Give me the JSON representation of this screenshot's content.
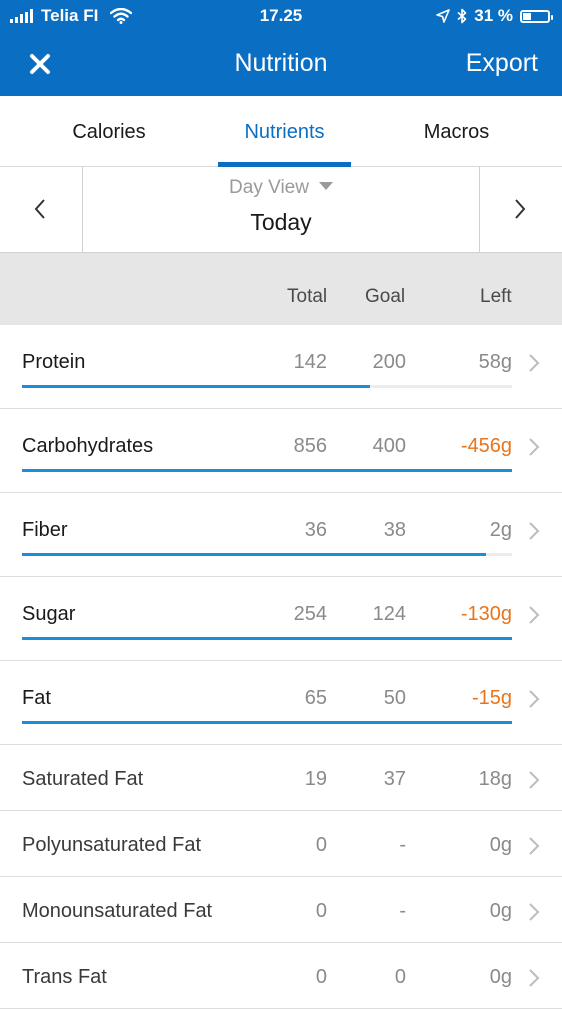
{
  "status": {
    "carrier": "Telia FI",
    "time": "17.25",
    "battery_pct": "31 %",
    "battery_level": 0.31
  },
  "nav": {
    "title": "Nutrition",
    "export_label": "Export"
  },
  "tabs": [
    {
      "label": "Calories",
      "active": false
    },
    {
      "label": "Nutrients",
      "active": true
    },
    {
      "label": "Macros",
      "active": false
    }
  ],
  "day_view": {
    "label": "Day View",
    "date": "Today"
  },
  "columns": {
    "total": "Total",
    "goal": "Goal",
    "left": "Left"
  },
  "nutrients": [
    {
      "name": "Protein",
      "total": "142",
      "goal": "200",
      "left": "58g",
      "over": false,
      "progress": 0.71
    },
    {
      "name": "Carbohydrates",
      "total": "856",
      "goal": "400",
      "left": "-456g",
      "over": true,
      "progress": 1.0
    },
    {
      "name": "Fiber",
      "total": "36",
      "goal": "38",
      "left": "2g",
      "over": false,
      "progress": 0.947
    },
    {
      "name": "Sugar",
      "total": "254",
      "goal": "124",
      "left": "-130g",
      "over": true,
      "progress": 1.0
    },
    {
      "name": "Fat",
      "total": "65",
      "goal": "50",
      "left": "-15g",
      "over": true,
      "progress": 1.0
    }
  ],
  "sub_nutrients": [
    {
      "name": "Saturated Fat",
      "total": "19",
      "goal": "37",
      "left": "18g"
    },
    {
      "name": "Polyunsaturated Fat",
      "total": "0",
      "goal": "-",
      "left": "0g"
    },
    {
      "name": "Monounsaturated Fat",
      "total": "0",
      "goal": "-",
      "left": "0g"
    },
    {
      "name": "Trans Fat",
      "total": "0",
      "goal": "0",
      "left": "0g"
    }
  ],
  "colors": {
    "brand": "#0a6fc2",
    "bar": "#1a8fd8",
    "over": "#e8741b"
  }
}
